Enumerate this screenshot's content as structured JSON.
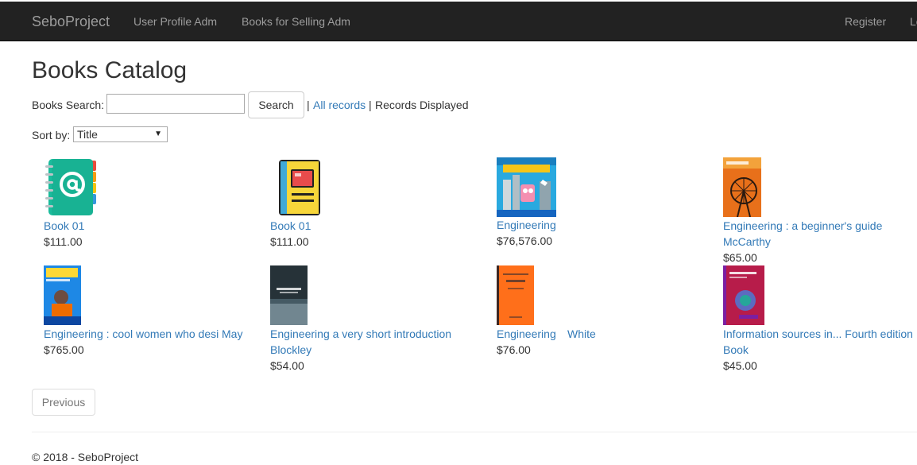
{
  "navbar": {
    "brand": "SeboProject",
    "links": [
      "User Profile Adm",
      "Books for Selling Adm"
    ],
    "right_links": [
      "Register",
      "Log in"
    ]
  },
  "page_title": "Books Catalog",
  "search": {
    "label": "Books Search:",
    "value": "",
    "placeholder": "",
    "button": "Search",
    "separator": "|",
    "all_records": "All records",
    "records_displayed": "Records Displayed"
  },
  "sort": {
    "label": "Sort by:",
    "selected": "Title"
  },
  "books": [
    {
      "title": "Book 01",
      "author": "",
      "price": "$111.00",
      "cover": "address-book-icon"
    },
    {
      "title": "Book 01",
      "author": "",
      "price": "$111.00",
      "cover": "notebook-icon"
    },
    {
      "title": "Engineering",
      "author": "",
      "price": "$76,576.00",
      "cover": "engineering-cartoon-cover"
    },
    {
      "title": "Engineering : a beginner's guide",
      "author": "McCarthy",
      "price": "$65.00",
      "cover": "ferris-wheel-cover"
    },
    {
      "title": "Engineering : cool women who desi",
      "author": "May",
      "price": "$765.00",
      "cover": "cool-women-cover"
    },
    {
      "title": "Engineering a very short introduction",
      "author": "Blockley",
      "price": "$54.00",
      "cover": "short-introduction-cover"
    },
    {
      "title": "Engineering",
      "author": "White",
      "price": "$76.00",
      "cover": "orange-cover"
    },
    {
      "title": "Information sources in... Fourth edition",
      "author": "Book",
      "price": "$45.00",
      "cover": "information-sources-cover"
    }
  ],
  "pagination": {
    "previous": "Previous"
  },
  "footer": "© 2018 - SeboProject",
  "colors": {
    "navbar": "#222222",
    "link": "#337ab7",
    "nav_text": "#9d9d9d"
  }
}
